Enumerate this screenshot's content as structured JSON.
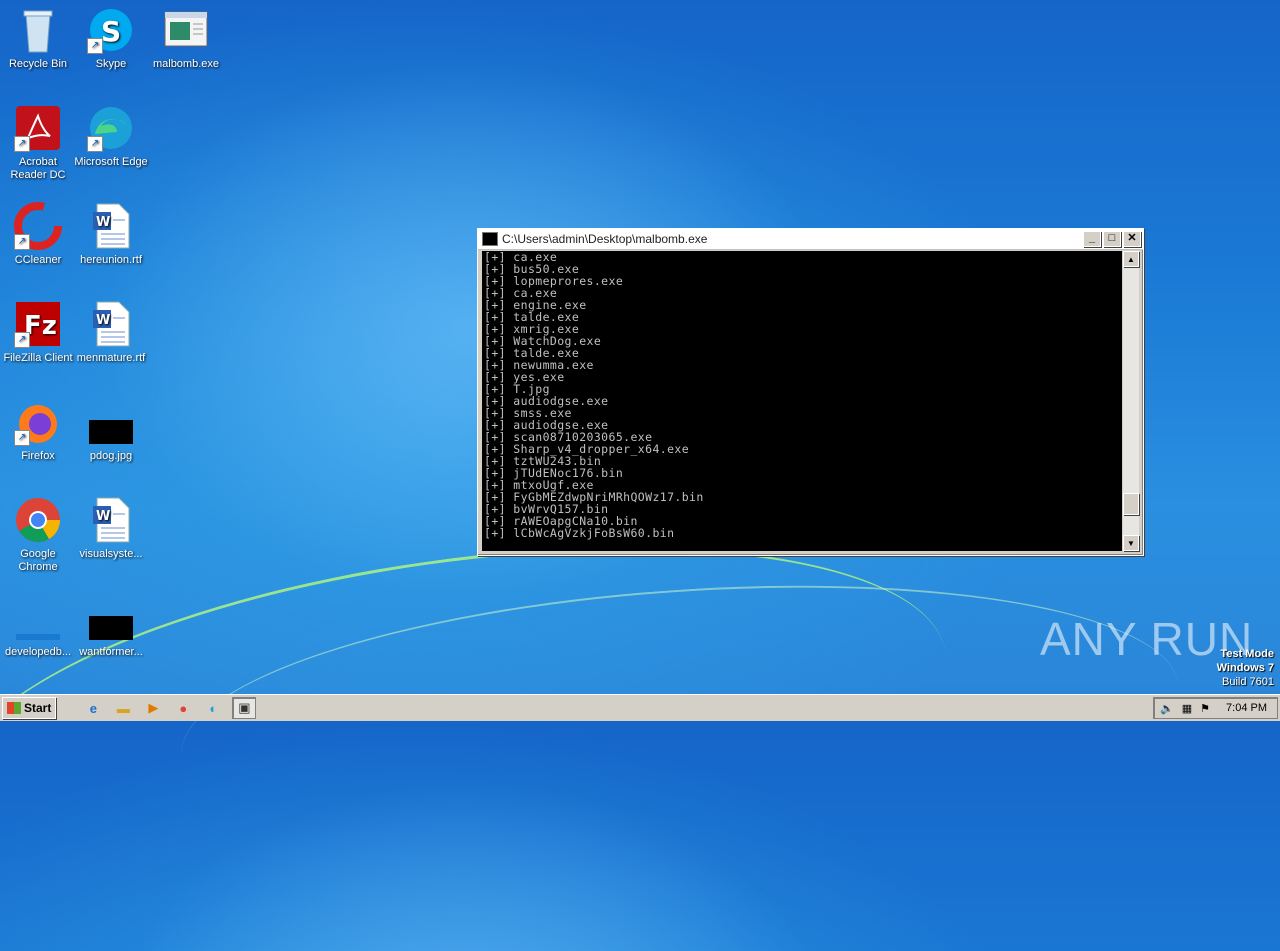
{
  "desktop": {
    "icons": [
      {
        "label": "Recycle Bin"
      },
      {
        "label": "Skype"
      },
      {
        "label": "malbomb.exe"
      },
      {
        "label": "Acrobat Reader DC"
      },
      {
        "label": "Microsoft Edge"
      },
      {
        "label": "CCleaner"
      },
      {
        "label": "hereunion.rtf"
      },
      {
        "label": "FileZilla Client"
      },
      {
        "label": "menmature.rtf"
      },
      {
        "label": "Firefox"
      },
      {
        "label": "pdog.jpg"
      },
      {
        "label": "Google Chrome"
      },
      {
        "label": "visualsyste..."
      },
      {
        "label": "developedb..."
      },
      {
        "label": "wantformer..."
      }
    ]
  },
  "console_window": {
    "title": "C:\\Users\\admin\\Desktop\\malbomb.exe",
    "lines": [
      "[+] ca.exe",
      "[+] bus50.exe",
      "[+] lopmeprores.exe",
      "[+] ca.exe",
      "[+] engine.exe",
      "[+] talde.exe",
      "[+] xmrig.exe",
      "[+] WatchDog.exe",
      "[+] talde.exe",
      "[+] newumma.exe",
      "[+] yes.exe",
      "[+] T.jpg",
      "[+] audiodgse.exe",
      "[+] smss.exe",
      "[+] audiodgse.exe",
      "[+] scan08710203065.exe",
      "[+] Sharp_v4_dropper_x64.exe",
      "[+] tztWU243.bin",
      "[+] jTUdENoc176.bin",
      "[+] mtxoUgf.exe",
      "[+] FyGbMEZdwpNriMRhQOWz17.bin",
      "[+] bvWrvQ157.bin",
      "[+] rAWEOapgCNa10.bin",
      "[+] lCbWcAgVzkjFoBsW60.bin"
    ],
    "scroll_position": 0.92
  },
  "watermark": {
    "brand": "ANY RUN",
    "test_mode": "Test Mode",
    "os": "Windows 7",
    "build": "Build 7601"
  },
  "taskbar": {
    "start_label": "Start",
    "clock": "7:04 PM"
  }
}
